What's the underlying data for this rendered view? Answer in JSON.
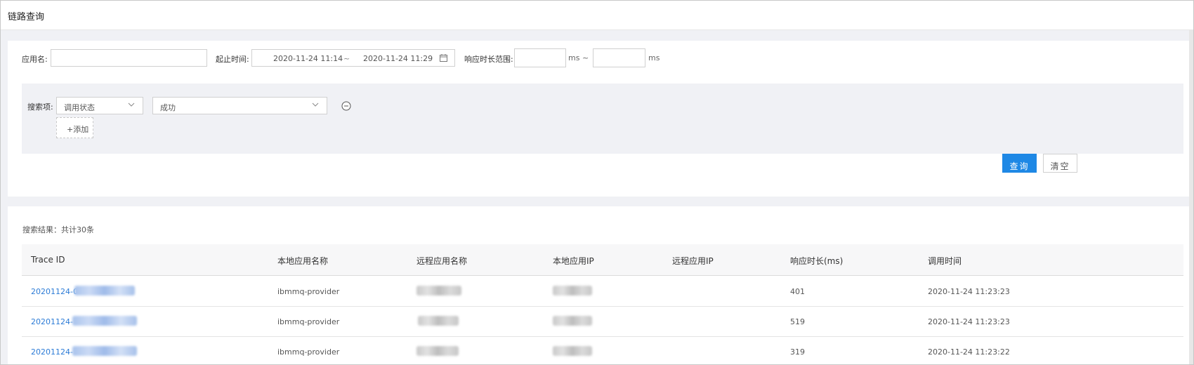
{
  "header": {
    "title": "链路查询"
  },
  "search": {
    "app_name_label": "应用名:",
    "app_name_value": "",
    "time_label": "起止时间:",
    "start_time": "2020-11-24 11:14",
    "time_separator": "~",
    "end_time": "2020-11-24 11:29",
    "duration_label": "响应时长范围:",
    "duration_min": "",
    "duration_unit_mid": "ms ~",
    "duration_max": "",
    "duration_unit_end": "ms",
    "filters_label": "搜索项:",
    "filter_field": "调用状态",
    "filter_value": "成功",
    "add_label": "+添加",
    "query_button": "查询",
    "clear_button": "清空"
  },
  "results": {
    "summary": "搜索结果：共计30条",
    "columns": [
      "Trace ID",
      "本地应用名称",
      "远程应用名称",
      "本地应用IP",
      "远程应用IP",
      "响应时长(ms)",
      "调用时间"
    ],
    "rows": [
      {
        "trace_id": "20201124-0",
        "local_app": "ibmmq-provider",
        "remote_app": "",
        "local_ip": "",
        "remote_ip": "",
        "duration": "401",
        "call_time": "2020-11-24 11:23:23"
      },
      {
        "trace_id": "20201124-",
        "local_app": "ibmmq-provider",
        "remote_app": "",
        "local_ip": "",
        "remote_ip": "",
        "duration": "519",
        "call_time": "2020-11-24 11:23:23"
      },
      {
        "trace_id": "20201124-",
        "local_app": "ibmmq-provider",
        "remote_app": "",
        "local_ip": "",
        "remote_ip": "",
        "duration": "319",
        "call_time": "2020-11-24 11:23:22"
      }
    ]
  },
  "colors": {
    "primary": "#1e88e5",
    "link": "#2b7bd6",
    "panel_bg": "#f0f1f5"
  },
  "icons": [
    "calendar-icon",
    "chevron-down-icon",
    "minus-circle-icon"
  ]
}
